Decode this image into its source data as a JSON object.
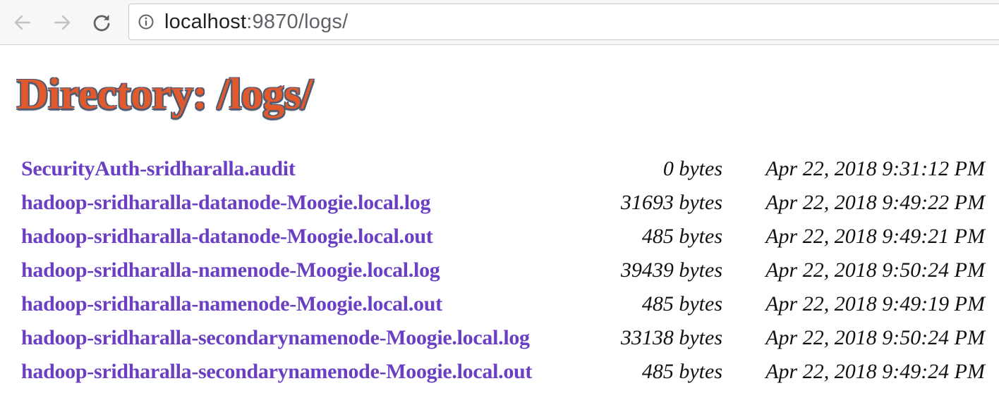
{
  "browser": {
    "url_host": "localhost",
    "url_rest": ":9870/logs/",
    "icons": {
      "back": "arrow-left-icon",
      "forward": "arrow-right-icon",
      "reload": "reload-icon",
      "info": "info-icon"
    }
  },
  "page": {
    "title": "Directory: /logs/",
    "title_color": "#e05a2e",
    "link_color": "#6a3fc4",
    "files": [
      {
        "name": "SecurityAuth-sridharalla.audit",
        "size": "0 bytes",
        "date": "Apr 22, 2018 9:31:12 PM"
      },
      {
        "name": "hadoop-sridharalla-datanode-Moogie.local.log",
        "size": "31693 bytes",
        "date": "Apr 22, 2018 9:49:22 PM"
      },
      {
        "name": "hadoop-sridharalla-datanode-Moogie.local.out",
        "size": "485 bytes",
        "date": "Apr 22, 2018 9:49:21 PM"
      },
      {
        "name": "hadoop-sridharalla-namenode-Moogie.local.log",
        "size": "39439 bytes",
        "date": "Apr 22, 2018 9:50:24 PM"
      },
      {
        "name": "hadoop-sridharalla-namenode-Moogie.local.out",
        "size": "485 bytes",
        "date": "Apr 22, 2018 9:49:19 PM"
      },
      {
        "name": "hadoop-sridharalla-secondarynamenode-Moogie.local.log",
        "size": "33138 bytes",
        "date": "Apr 22, 2018 9:50:24 PM"
      },
      {
        "name": "hadoop-sridharalla-secondarynamenode-Moogie.local.out",
        "size": "485 bytes",
        "date": "Apr 22, 2018 9:49:24 PM"
      }
    ]
  }
}
